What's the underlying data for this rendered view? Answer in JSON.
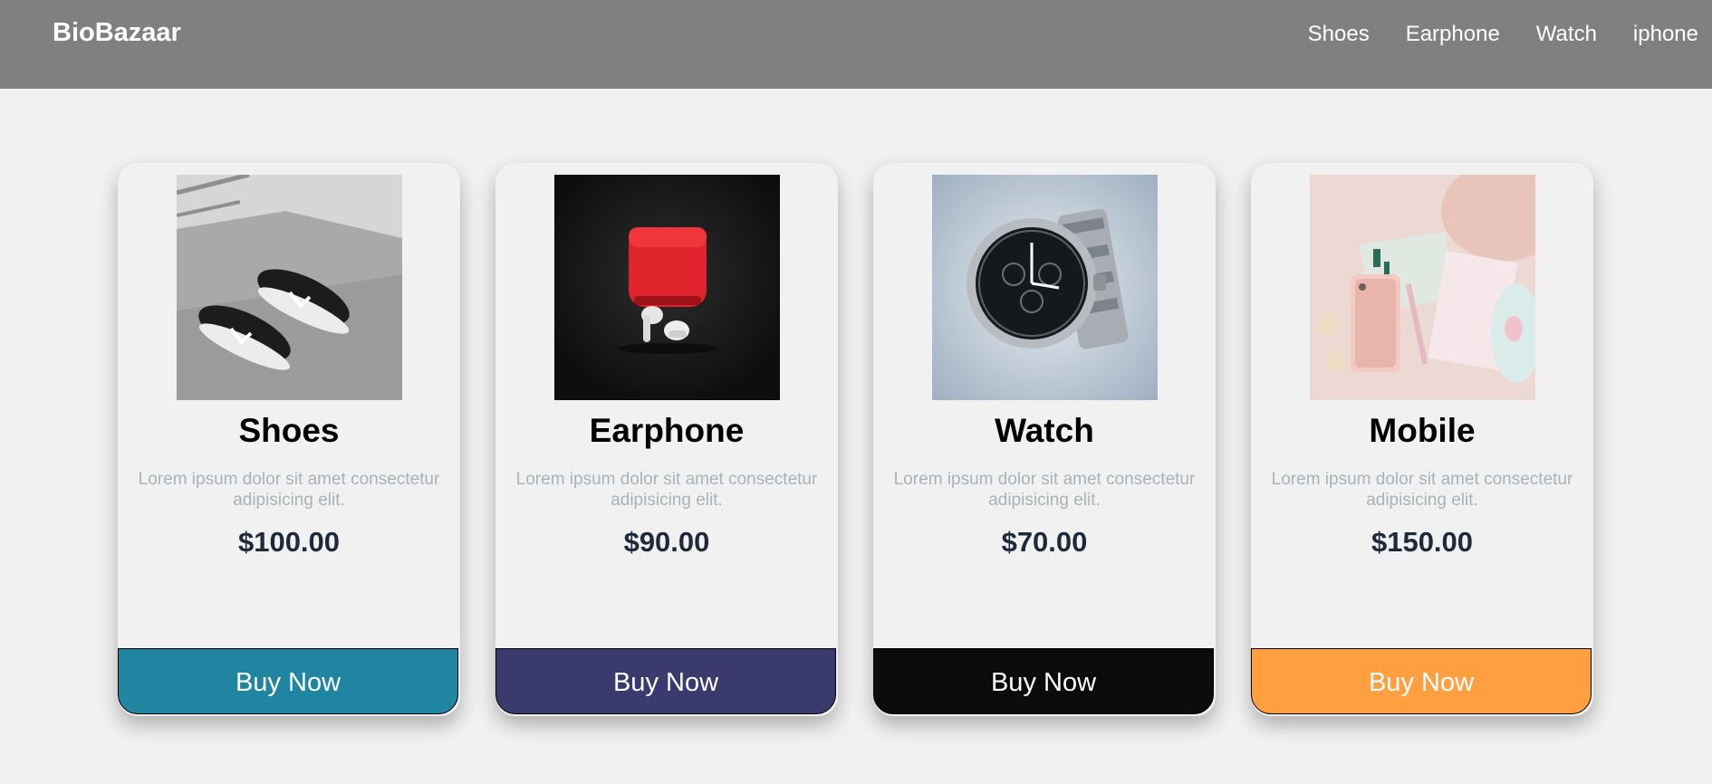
{
  "navbar": {
    "brand": "BioBazaar",
    "links": [
      "Shoes",
      "Earphone",
      "Watch",
      "iphone"
    ]
  },
  "products": [
    {
      "title": "Shoes",
      "description": "Lorem ipsum dolor sit amet consectetur adipisicing elit.",
      "price": "$100.00",
      "button_label": "Buy Now",
      "button_color": "#2085a1"
    },
    {
      "title": "Earphone",
      "description": "Lorem ipsum dolor sit amet consectetur adipisicing elit.",
      "price": "$90.00",
      "button_label": "Buy Now",
      "button_color": "#3b3a6e"
    },
    {
      "title": "Watch",
      "description": "Lorem ipsum dolor sit amet consectetur adipisicing elit.",
      "price": "$70.00",
      "button_label": "Buy Now",
      "button_color": "#0b0b0b"
    },
    {
      "title": "Mobile",
      "description": "Lorem ipsum dolor sit amet consectetur adipisicing elit.",
      "price": "$150.00",
      "button_label": "Buy Now",
      "button_color": "#ff9f40"
    }
  ],
  "colors": {
    "navbar_bg": "#808080",
    "page_bg": "#f1f1f1",
    "title_text": "#000000",
    "desc_text": "#a7b3b9",
    "price_text": "#1e2a3a"
  }
}
